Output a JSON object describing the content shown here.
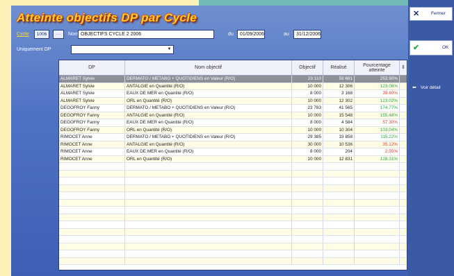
{
  "title": "Atteinte objectifs DP par Cycle",
  "filters": {
    "cycle_label": "Cycle",
    "cycle_code": "1006",
    "nom_label": "Nom",
    "nom_value": "OBJECTIFS CYCLE 2 2006",
    "du_label": "du",
    "du_value": "01/09/2006",
    "au_label": "au",
    "au_value": "31/12/2006",
    "uniquement_label": "Uniquement DP",
    "uniquement_value": ""
  },
  "table": {
    "headers": [
      "DP",
      "Nom objectif",
      "Objectif",
      "Réalisé",
      "Pourcentage atteinte"
    ],
    "rows": [
      {
        "dp": "ALMARET Sylvie",
        "nom": "DERMATO / METABO + QUOTIDIENS en Valeur (R/O)",
        "objectif": "23 110",
        "realise": "58 681",
        "pct": "253.90%",
        "color": "green",
        "selected": true
      },
      {
        "dp": "ALMARET Sylvie",
        "nom": "ANTALGIE en Quantité (R/O)",
        "objectif": "10 000",
        "realise": "12 306",
        "pct": "123.06%",
        "color": "green",
        "selected": false
      },
      {
        "dp": "ALMARET Sylvie",
        "nom": "EAUX DE MER en Quantité (R/O)",
        "objectif": "8 000",
        "realise": "3 168",
        "pct": "39.60%",
        "color": "red",
        "selected": false
      },
      {
        "dp": "ALMARET Sylvie",
        "nom": "ORL en Quantité (R/O)",
        "objectif": "10 000",
        "realise": "12 302",
        "pct": "123.02%",
        "color": "green",
        "selected": false
      },
      {
        "dp": "DEGOFROY Fanny",
        "nom": "DERMATO / METABO + QUOTIDIENS en Valeur (R/O)",
        "objectif": "23 783",
        "realise": "41 565",
        "pct": "174.77%",
        "color": "green",
        "selected": false
      },
      {
        "dp": "DEGOFROY Fanny",
        "nom": "ANTALGIE en Quantité (R/O)",
        "objectif": "10 000",
        "realise": "15 548",
        "pct": "155.48%",
        "color": "green",
        "selected": false
      },
      {
        "dp": "DEGOFROY Fanny",
        "nom": "EAUX DE MER en Quantité (R/O)",
        "objectif": "8 000",
        "realise": "4 584",
        "pct": "57.30%",
        "color": "red",
        "selected": false
      },
      {
        "dp": "DEGOFROY Fanny",
        "nom": "ORL en Quantité (R/O)",
        "objectif": "10 000",
        "realise": "10 304",
        "pct": "103.04%",
        "color": "green",
        "selected": false
      },
      {
        "dp": "RIMOCET Anne",
        "nom": "DERMATO / METABO + QUOTIDIENS en Valeur (R/O)",
        "objectif": "29 385",
        "realise": "33 858",
        "pct": "115.22%",
        "color": "green",
        "selected": false
      },
      {
        "dp": "RIMOCET Anne",
        "nom": "ANTALGIE en Quantité (R/O)",
        "objectif": "30 000",
        "realise": "10 536",
        "pct": "35.12%",
        "color": "red",
        "selected": false
      },
      {
        "dp": "RIMOCET Anne",
        "nom": "EAUX DE MER en Quantité (R/O)",
        "objectif": "8 000",
        "realise": "204",
        "pct": "2.55%",
        "color": "red",
        "selected": false
      },
      {
        "dp": "RIMOCET Anne",
        "nom": "ORL en Quantité (R/O)",
        "objectif": "10 000",
        "realise": "12 831",
        "pct": "128.31%",
        "color": "green",
        "selected": false
      }
    ]
  },
  "right_panel": {
    "fermer_label": "Fermer",
    "ok_label": "OK",
    "voir_label": "Voir détail"
  },
  "colors": {
    "title_yellow": "#ffcf2a",
    "title_shadow": "#a3300d",
    "window_blue": "#4f73c4",
    "pct_green": "#2ea84a",
    "pct_red": "#e23a2a",
    "selected_row": "#8d8f99"
  },
  "icons": {
    "close": "close-x-icon",
    "ok": "checkmark-icon",
    "detail": "arrow-left-icon"
  }
}
